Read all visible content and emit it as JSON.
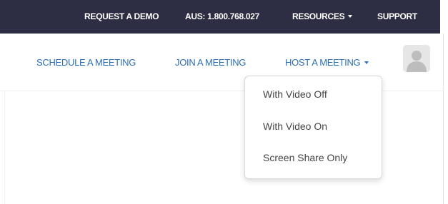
{
  "topbar": {
    "request_demo": "REQUEST A DEMO",
    "phone": "AUS: 1.800.768.027",
    "resources": "RESOURCES",
    "support": "SUPPORT"
  },
  "nav": {
    "schedule": "SCHEDULE A MEETING",
    "join": "JOIN A MEETING",
    "host": "HOST A MEETING"
  },
  "dropdown": {
    "items": [
      {
        "label": "With Video Off"
      },
      {
        "label": "With Video On"
      },
      {
        "label": "Screen Share Only"
      }
    ]
  },
  "icons": {
    "resources_caret": "chevron-down-icon",
    "host_caret": "chevron-down-icon",
    "avatar": "user-avatar-icon"
  },
  "colors": {
    "topbar_bg": "#2d2d44",
    "nav_link": "#2d6fb5",
    "menu_text": "#444444"
  }
}
